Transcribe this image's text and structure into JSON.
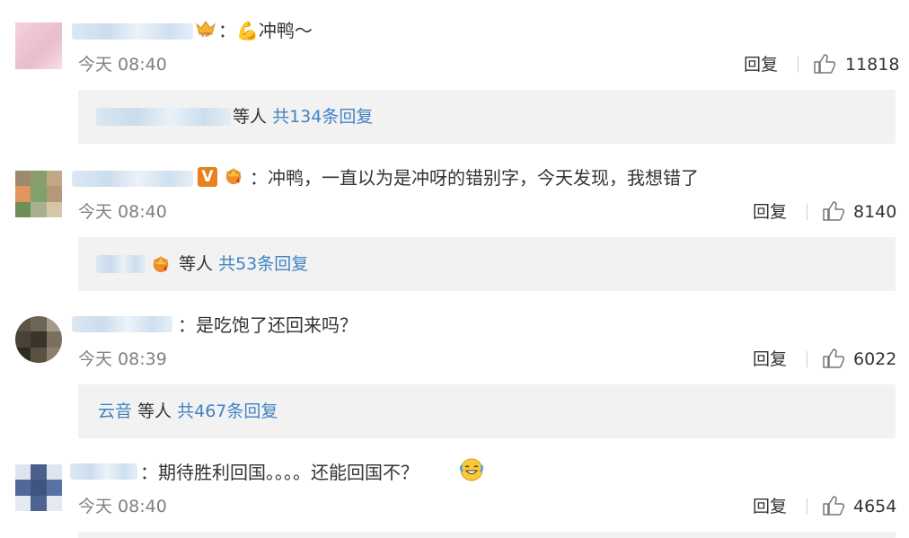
{
  "comments": [
    {
      "text": "：💪冲鸭～",
      "time": "今天 08:40",
      "reply_label": "回复",
      "likes": "11818",
      "sub": {
        "prefix_name": "",
        "label_people": "等人",
        "label_total": "共134条回复"
      }
    },
    {
      "text": "：冲鸭，一直以为是冲呀的错别字，今天发现，我想错了",
      "time": "今天 08:40",
      "reply_label": "回复",
      "likes": "8140",
      "badge_letter": "V",
      "sub": {
        "prefix_name": "",
        "label_people": "等人",
        "label_total": "共53条回复"
      }
    },
    {
      "text": "：是吃饱了还回来吗？",
      "time": "今天 08:39",
      "reply_label": "回复",
      "likes": "6022",
      "sub": {
        "prefix_name": "云音",
        "label_people": "等人",
        "label_total": "共467条回复"
      }
    },
    {
      "text": "：期待胜利回国。。。。还能回国不？",
      "time": "今天 08:40",
      "reply_label": "回复",
      "likes": "4654"
    }
  ],
  "icons": {
    "like": "thumbs-up-icon",
    "vip": "vip-crown-icon",
    "emoji": "laugh-cry-emoji"
  },
  "colors": {
    "link": "#4183c4",
    "subbox_bg": "#f2f2f2",
    "time": "#808080"
  }
}
